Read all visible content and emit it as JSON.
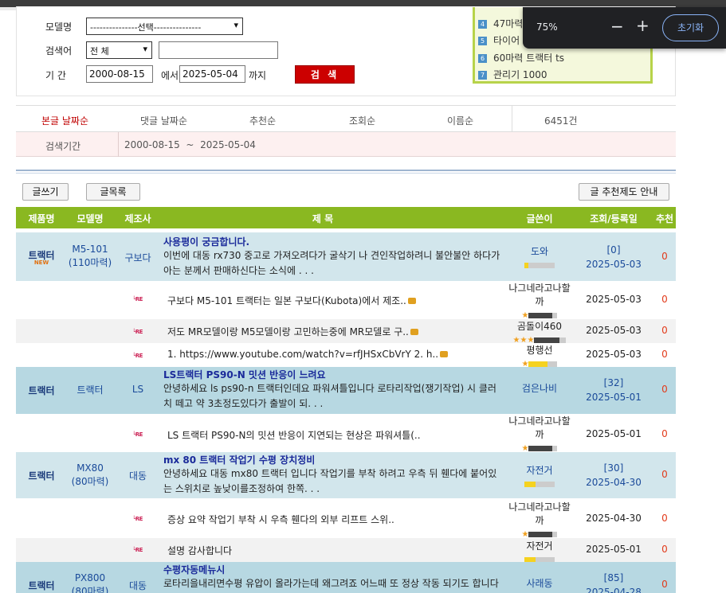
{
  "search": {
    "model_label": "모델명",
    "model_select": "---------------선택---------------",
    "keyword_label": "검색어",
    "keyword_select": "전 체",
    "keyword_value": "",
    "period_label": "기 간",
    "date_from": "2000-08-15",
    "from_suffix": "에서",
    "date_to": "2025-05-04",
    "to_suffix": "까지",
    "search_button": "검 색"
  },
  "ranking": [
    {
      "num": "4",
      "text": "47마력"
    },
    {
      "num": "5",
      "text": "타이어"
    },
    {
      "num": "6",
      "text": "60마력 트랙터 ts"
    },
    {
      "num": "7",
      "text": "관리기 1000"
    }
  ],
  "zoom": {
    "level": "75%",
    "minus": "−",
    "plus": "+",
    "reset": "초기화"
  },
  "sort": {
    "items": [
      "본글 날짜순",
      "댓글 날짜순",
      "추천순",
      "조회순",
      "이름순"
    ],
    "active": "본글 날짜순",
    "count": "6451건"
  },
  "period": {
    "label": "검색기간",
    "from": "2000-08-15",
    "sep": "~",
    "to": "2025-05-04"
  },
  "toolbar": {
    "write": "글쓰기",
    "list": "글목록",
    "recommend_guide": "글 추천제도 안내"
  },
  "columns": [
    "제품명",
    "모델명",
    "제조사",
    "제 목",
    "글쓴이",
    "조회/등록일",
    "추천"
  ],
  "rows": [
    {
      "type": "main",
      "category": "트랙터",
      "new": "NEW",
      "model": "M5-101",
      "model2": "(110마력)",
      "maker": "구보다",
      "title": "사용평이 궁금합니다.",
      "body1": "이번에 대동 rx730 중고로 가져오려다가 굴삭기 나 견인작업하려니 불안불안 하다가",
      "body2": "아는 분께서 판매하신다는 소식에 . . .",
      "author": "도와",
      "views": "[0]",
      "date": "2025-05-03",
      "rec": "0"
    },
    {
      "type": "reply",
      "icon": "└RE",
      "text": "구보다 M5-101 트랙터는 일본 구보다(Kubota)에서 제조..",
      "author1": "나그네라고나할",
      "author2": "까",
      "date": "2025-05-03",
      "rec": "0"
    },
    {
      "type": "reply",
      "icon": "└RE",
      "text": "저도 MR모델이랑 M5모델이랑 고민하는중에 MR모델로 구..",
      "author1": "곰돌이460",
      "author2": "",
      "date": "2025-05-03",
      "rec": "0"
    },
    {
      "type": "reply",
      "icon": "└RE",
      "text": "1. https://www.youtube.com/watch?v=rfJHSxCbVrY 2. h..",
      "author1": "평행선",
      "author2": "",
      "date": "2025-05-03",
      "rec": "0"
    },
    {
      "type": "main",
      "category": "트랙터",
      "new": "",
      "model": "트랙터",
      "model2": "",
      "maker": "LS",
      "title": "LS트랙터 PS90-N 밋션 반응이 느려요",
      "body1": "안녕하세요 ls ps90-n 트랙터인데요 파워셔틀입니다 로타리작업(쟁기작업) 시 클러",
      "body2": "치 떼고 약 3초정도있다가 출발이 되. . .",
      "author": "검은나비",
      "views": "[32]",
      "date": "2025-05-01",
      "rec": "0"
    },
    {
      "type": "reply",
      "icon": "└RE",
      "text": "LS 트랙터 PS90-N의 밋션 반응이 지연되는 현상은 파워셔틀(..",
      "author1": "나그네라고나할",
      "author2": "까",
      "date": "2025-05-01",
      "rec": "0"
    },
    {
      "type": "main",
      "category": "트랙터",
      "new": "",
      "model": "MX80",
      "model2": "(80마력)",
      "maker": "대동",
      "title": "mx 80 트랙터 작업기 수평 장치정비",
      "body1": "안녕하세요 대동 mx80 트랙터 입니다 작업기를 부착 하려고 우측 뒤 휀다에 붙어있",
      "body2": "는 스위치로 높낮이를조정하여 한쪽. . .",
      "author": "자전거",
      "views": "[30]",
      "date": "2025-04-30",
      "rec": "0"
    },
    {
      "type": "reply",
      "icon": "└RE",
      "text": "증상 요약 작업기 부착 시 우측 휀다의 외부 리프트 스위..",
      "author1": "나그네라고나할",
      "author2": "까",
      "date": "2025-04-30",
      "rec": "0"
    },
    {
      "type": "reply",
      "icon": "└RE",
      "text": "설명 감사합니다",
      "author1": "자전거",
      "author2": "",
      "date": "2025-05-01",
      "rec": "0"
    },
    {
      "type": "main",
      "category": "트랙터",
      "new": "",
      "model": "PX800",
      "model2": "(80마력)",
      "maker": "대동",
      "title": "수평자동메뉴시",
      "body1": "로타리을내리면수평 유압이 올라가는데 왜그려죠 어느때 또 정상 작동 되기도 합니다",
      "body2": "",
      "author": "사래동",
      "views": "[85]",
      "date": "2025-04-28",
      "rec": "0"
    }
  ]
}
